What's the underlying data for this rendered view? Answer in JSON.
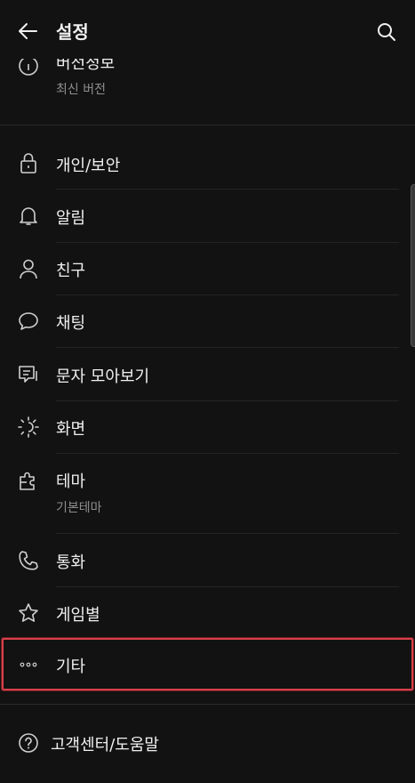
{
  "header": {
    "title": "설정",
    "back_icon": "arrow-left-icon",
    "search_icon": "search-icon"
  },
  "version": {
    "title": "버전정보",
    "subtitle": "최신 버전",
    "icon": "info-icon"
  },
  "menu": [
    {
      "id": "privacy",
      "label": "개인/보안",
      "icon": "lock-icon"
    },
    {
      "id": "notification",
      "label": "알림",
      "icon": "bell-icon"
    },
    {
      "id": "friends",
      "label": "친구",
      "icon": "person-icon"
    },
    {
      "id": "chat",
      "label": "채팅",
      "icon": "chat-bubble-icon"
    },
    {
      "id": "sms",
      "label": "문자 모아보기",
      "icon": "message-list-icon"
    },
    {
      "id": "display",
      "label": "화면",
      "icon": "brightness-icon"
    },
    {
      "id": "theme",
      "label": "테마",
      "subtitle": "기본테마",
      "icon": "puzzle-icon"
    },
    {
      "id": "call",
      "label": "통화",
      "icon": "phone-icon"
    },
    {
      "id": "game",
      "label": "게임별",
      "icon": "star-icon"
    },
    {
      "id": "etc",
      "label": "기타",
      "icon": "more-dots-icon"
    }
  ],
  "help": {
    "label": "고객센터/도움말",
    "icon": "help-circle-icon"
  },
  "colors": {
    "background": "#121212",
    "text": "#f0f0f0",
    "subtext": "#8e8e8e",
    "highlight": "#d9414a"
  }
}
